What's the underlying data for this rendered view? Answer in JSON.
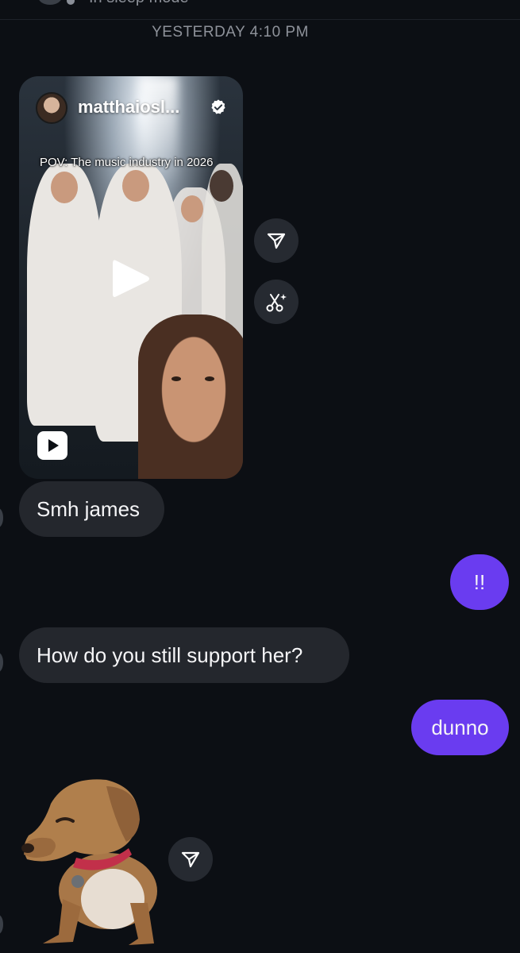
{
  "header": {
    "status_text": "In sleep mode"
  },
  "timestamp": "YESTERDAY 4:10 PM",
  "reel": {
    "author": "matthaiosl...",
    "caption": "POV: The music industry in 2026",
    "icons": {
      "verified": "verified-badge-icon",
      "play": "play-icon",
      "reels": "reels-icon"
    }
  },
  "actions": {
    "share_icon": "paper-plane-icon",
    "remix_icon": "scissors-sparkle-icon"
  },
  "messages": [
    {
      "direction": "incoming",
      "text": "Smh james"
    },
    {
      "direction": "outgoing",
      "text": "!!"
    },
    {
      "direction": "incoming",
      "text": "How do you still support her?"
    },
    {
      "direction": "outgoing",
      "text": "dunno"
    }
  ],
  "sticker": {
    "subject": "dachshund-dog-sticker"
  },
  "colors": {
    "background": "#0c0f14",
    "incoming_bubble": "#24272d",
    "outgoing_bubble": "#6a3cf0",
    "timestamp_text": "#8e929a"
  }
}
